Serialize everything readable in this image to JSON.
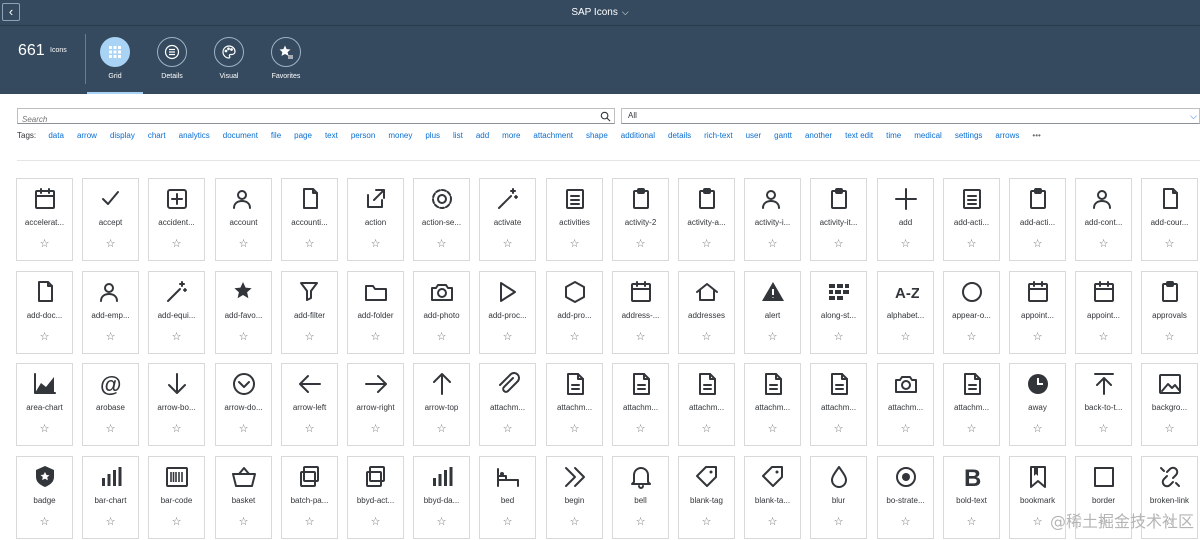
{
  "shell": {
    "title": "SAP Icons"
  },
  "header": {
    "count": "661",
    "count_label": "Icons",
    "tabs": [
      {
        "label": "Grid",
        "icon": "grid-icon",
        "active": true
      },
      {
        "label": "Details",
        "icon": "list-icon",
        "active": false
      },
      {
        "label": "Visual",
        "icon": "palette-icon",
        "active": false
      },
      {
        "label": "Favorites",
        "icon": "favorites-icon",
        "active": false
      }
    ]
  },
  "search": {
    "placeholder": "Search",
    "category": "All"
  },
  "tags": {
    "label": "Tags:",
    "items": [
      "data",
      "arrow",
      "display",
      "chart",
      "analytics",
      "document",
      "file",
      "page",
      "text",
      "person",
      "money",
      "plus",
      "list",
      "add",
      "more",
      "attachment",
      "shape",
      "additional",
      "details",
      "rich-text",
      "user",
      "gantt",
      "another",
      "text edit",
      "time",
      "medical",
      "settings",
      "arrows"
    ],
    "more": "•••"
  },
  "icons": [
    [
      "accelerat...",
      "accept",
      "accident...",
      "account",
      "accounti...",
      "action",
      "action-se...",
      "activate",
      "activities",
      "activity-2",
      "activity-a...",
      "activity-i...",
      "activity-it...",
      "add",
      "add-acti...",
      "add-acti...",
      "add-cont...",
      "add-cour..."
    ],
    [
      "add-doc...",
      "add-emp...",
      "add-equi...",
      "add-favo...",
      "add-filter",
      "add-folder",
      "add-photo",
      "add-proc...",
      "add-pro...",
      "address-...",
      "addresses",
      "alert",
      "along-st...",
      "alphabet...",
      "appear-o...",
      "appoint...",
      "appoint...",
      "approvals"
    ],
    [
      "area-chart",
      "arobase",
      "arrow-bo...",
      "arrow-do...",
      "arrow-left",
      "arrow-right",
      "arrow-top",
      "attachm...",
      "attachm...",
      "attachm...",
      "attachm...",
      "attachm...",
      "attachm...",
      "attachm...",
      "attachm...",
      "away",
      "back-to-t...",
      "backgro..."
    ],
    [
      "badge",
      "bar-chart",
      "bar-code",
      "basket",
      "batch-pa...",
      "bbyd-act...",
      "bbyd-da...",
      "bed",
      "begin",
      "bell",
      "blank-tag",
      "blank-ta...",
      "blur",
      "bo-strate...",
      "bold-text",
      "bookmark",
      "border",
      "broken-link"
    ]
  ],
  "favorite_glyph": "☆",
  "watermark": "@稀土掘金技术社区",
  "colors": {
    "shell": "#354a5f",
    "icon": "#32363a",
    "link": "#0a6ed1",
    "active_tab": "#a9d3f5"
  }
}
